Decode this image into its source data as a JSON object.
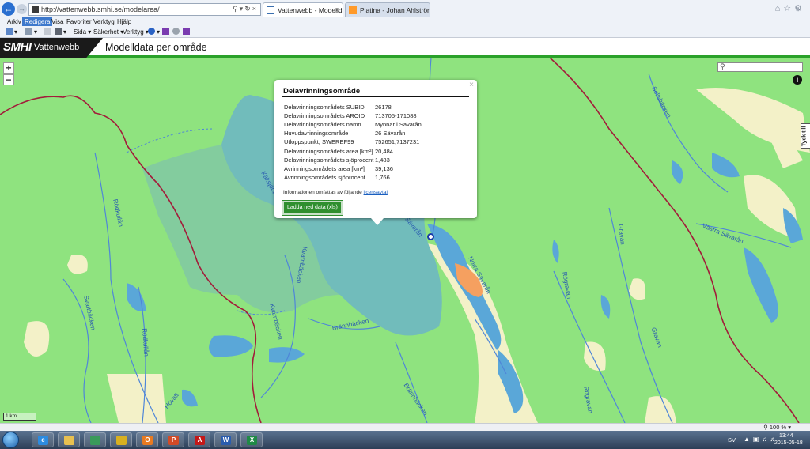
{
  "browser": {
    "address": "http://vattenwebb.smhi.se/modelarea/",
    "tabs": [
      {
        "label": "Vattenwebb - Modelldata p..."
      },
      {
        "label": "Platina - Johan Ahlström"
      }
    ],
    "menu": [
      "Arkiv",
      "Redigera",
      "Visa",
      "Favoriter",
      "Verktyg",
      "Hjälp"
    ],
    "commands": {
      "page": "Sida",
      "safety": "Säkerhet",
      "tools": "Verktyg"
    }
  },
  "header": {
    "logo": "SMHI",
    "brand": "Vattenwebb",
    "title": "Modelldata per område"
  },
  "map": {
    "zoom_in": "+",
    "zoom_out": "−",
    "feedback": "Tyck till",
    "scale": "1 km",
    "labels": {
      "sellsbacken": "Sellsbäcken",
      "kaksjobacken": "Käksjöbäcken",
      "rodkullan": "Rödkullån",
      "kvarnbacken": "Kvarnbäcken",
      "savaran1": "Sävarån",
      "savaran2": "Norra Sävarån",
      "rogravan1": "Rögravan",
      "gravan1": "Gravan",
      "vastra": "Västra Sävarån",
      "svartbacken": "Svartbäcken",
      "rodkullan2": "Rödkullån",
      "kvarnbacken2": "Kvarnbäcken",
      "brannbacken": "Brännbäcken",
      "brannbacken2": "Brännbäcken",
      "gravan2": "Gravan",
      "rogravan2": "Rögravan",
      "havatt": "Hövatt"
    }
  },
  "popup": {
    "close": "×",
    "title": "Delavrinningsområde",
    "rows": [
      {
        "k": "Delavrinningsområdets SUBID",
        "v": "26178"
      },
      {
        "k": "Delavrinningsområdets AROID",
        "v": "713705-171088"
      },
      {
        "k": "Delavrinningsområdets namn",
        "v": "Mynnar i Sävarån"
      },
      {
        "k": "Huvudavrinningsområde",
        "v": "26 Sävarån"
      },
      {
        "k": "Utloppspunkt, SWEREF99",
        "v": "752651,7137231"
      },
      {
        "k": "Delavrinningsområdets area [km²]",
        "v": "20,484"
      },
      {
        "k": "Delavrinningsområdets sjöprocent",
        "v": "1,483"
      },
      {
        "k": "Avrinningsområdets area [km²]",
        "v": "39,136"
      },
      {
        "k": "Avrinningsområdets sjöprocent",
        "v": "1,766"
      }
    ],
    "license_text": "Informationen omfattas av följande",
    "license_link": "licensavtal",
    "download": "Ladda ned data (xls)"
  },
  "status": {
    "zoom": "100 %"
  },
  "taskbar": {
    "lang": "SV",
    "time": "13:44",
    "date": "2015-05-18"
  }
}
